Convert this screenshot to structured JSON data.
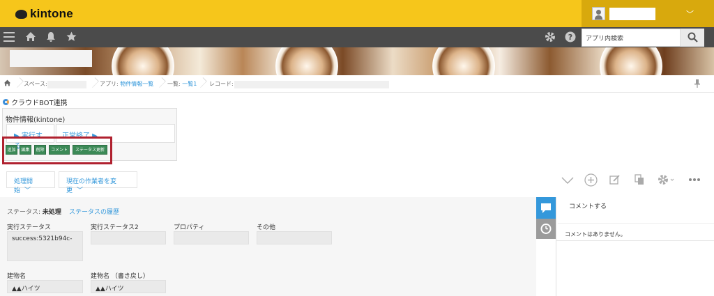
{
  "header": {
    "logo": "kintone"
  },
  "search": {
    "placeholder": "アプリ内検索"
  },
  "breadcrumb": {
    "space_label": "スペース:",
    "app_label": "アプリ:",
    "app_name": "物件情報一覧",
    "list_label": "一覧:",
    "list_name": "一覧1",
    "record_label": "レコード:"
  },
  "plugin": {
    "title": "クラウドBOT連携",
    "panel_label": "物件情報(kintone)",
    "run_label": "▶ 実行する",
    "result_label": "正常終了 ▶",
    "buttons": [
      "追加",
      "編集",
      "削除",
      "コメント",
      "ステータス更新"
    ]
  },
  "actions": {
    "start_label": "処理開始",
    "change_assignee_label": "現在の作業者を変更"
  },
  "record": {
    "status_label": "ステータス:",
    "status_value": "未処理",
    "history_link": "ステータスの履歴",
    "fields": [
      {
        "label": "実行ステータス",
        "value": "success:5321b94c-"
      },
      {
        "label": "実行ステータス2",
        "value": ""
      },
      {
        "label": "プロパティ",
        "value": ""
      },
      {
        "label": "その他",
        "value": ""
      },
      {
        "label": "建物名",
        "value": "▲▲ハイツ"
      },
      {
        "label": "建物名 （書き戻し）",
        "value": "▲▲ハイツ"
      }
    ]
  },
  "comments": {
    "input_placeholder": "コメントする",
    "empty_text": "コメントはありません。"
  },
  "colors": {
    "header": "#f6c61b",
    "nav": "#4b4b4b",
    "accent": "#3498db",
    "mini_button": "#3c8a57",
    "highlight": "#b0212f"
  }
}
